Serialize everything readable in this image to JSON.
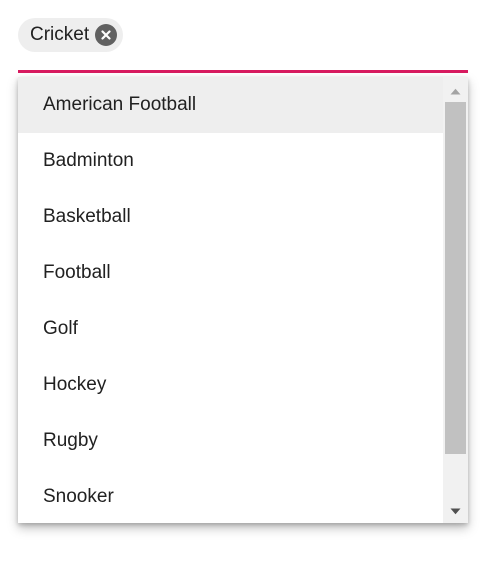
{
  "multiselect": {
    "chips": [
      {
        "label": "Cricket",
        "remove_icon": "close-circle-icon"
      }
    ],
    "accent_color": "#d81b60",
    "options": [
      {
        "label": "American Football",
        "highlighted": true
      },
      {
        "label": "Badminton",
        "highlighted": false
      },
      {
        "label": "Basketball",
        "highlighted": false
      },
      {
        "label": "Football",
        "highlighted": false
      },
      {
        "label": "Golf",
        "highlighted": false
      },
      {
        "label": "Hockey",
        "highlighted": false
      },
      {
        "label": "Rugby",
        "highlighted": false
      },
      {
        "label": "Snooker",
        "highlighted": false
      }
    ],
    "scrollbar": {
      "up_icon": "triangle-up-icon",
      "down_icon": "triangle-down-icon"
    }
  }
}
